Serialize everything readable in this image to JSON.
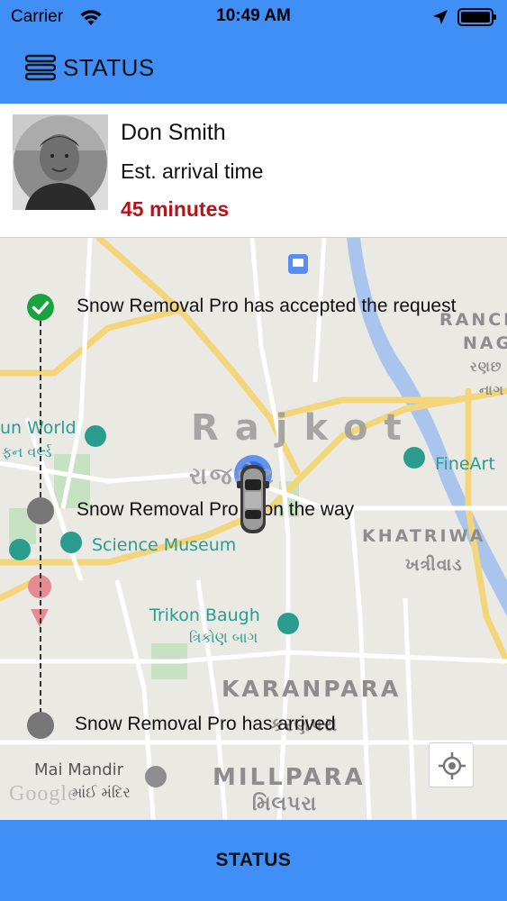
{
  "status_bar": {
    "carrier": "Carrier",
    "time": "10:49 AM"
  },
  "header": {
    "title": "STATUS",
    "menu_icon": "menu-icon"
  },
  "driver": {
    "name": "Don Smith",
    "eta_label": "Est. arrival time",
    "eta_value": "45 minutes",
    "eta_color": "#b3151b"
  },
  "map": {
    "labels": {
      "city": "Rajkot",
      "city_local": "રાજકોટ",
      "fun_world": "un World",
      "fun_world_local": "ફન વર્લ્ડ",
      "science_museum": "Science Museum",
      "trikon_baugh": "Trikon Baugh",
      "trikon_local": "ત્રિકોણ બાગ",
      "karanpara": "KARANPARA",
      "karanpara_local": "કરણપરા",
      "millpara": "MILLPARA",
      "millpara_local": "મિલપરા",
      "mai_mandir": "Mai Mandir",
      "mai_mandir_local": "માંઈ મંદિર",
      "fineart": "FineArt",
      "khatriwad": "KHATRIWA",
      "khatriwad_local": "ખત્રીવાડ",
      "ranch": "RANCH",
      "nag": "NAG",
      "ranch_local1": "રણછ",
      "ranch_local2": "નાગ",
      "google": "Google"
    }
  },
  "steps": [
    {
      "label": "Snow Removal Pro has accepted the request",
      "state": "done"
    },
    {
      "label": "Snow Removal Pro is on the way",
      "state": "pending"
    },
    {
      "label": "Snow Removal Pro has arrived",
      "state": "pending"
    }
  ],
  "bottom": {
    "button_label": "STATUS"
  },
  "colors": {
    "primary": "#3f8ff7",
    "done": "#19a33f",
    "pending": "#777777"
  }
}
